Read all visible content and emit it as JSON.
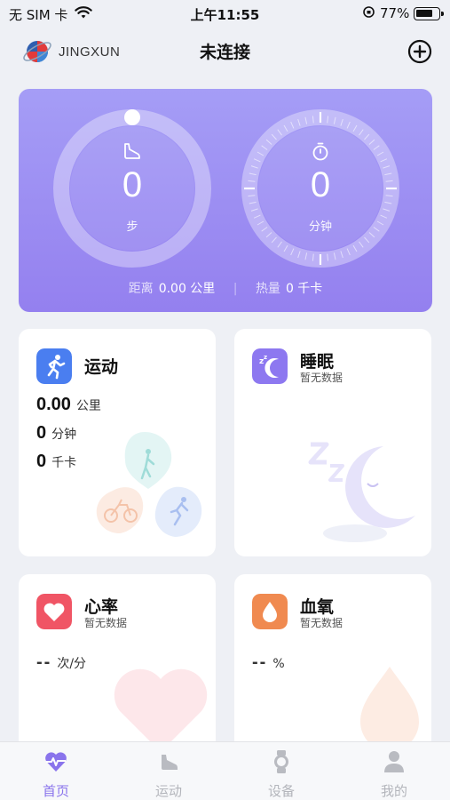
{
  "status": {
    "carrier": "无 SIM 卡",
    "time": "上午11:55",
    "battery": "77%",
    "battery_level": 0.77
  },
  "header": {
    "logo": "JINGXUN",
    "title": "未连接"
  },
  "summary": {
    "steps_value": "0",
    "steps_unit": "步",
    "duration_value": "0",
    "duration_unit": "分钟",
    "distance_label": "距离",
    "distance_value": "0.00 公里",
    "calories_label": "热量",
    "calories_value": "0 千卡",
    "separator": "|"
  },
  "cards": {
    "sport": {
      "title": "运动",
      "distance": "0.00",
      "distance_unit": "公里",
      "duration": "0",
      "duration_unit": "分钟",
      "calories": "0",
      "calories_unit": "千卡"
    },
    "sleep": {
      "title": "睡眠",
      "subtitle": "暂无数据"
    },
    "heart": {
      "title": "心率",
      "subtitle": "暂无数据",
      "value": "--",
      "unit": "次/分"
    },
    "oxygen": {
      "title": "血氧",
      "subtitle": "暂无数据",
      "value": "--",
      "unit": "%"
    }
  },
  "tabs": [
    {
      "label": "首页",
      "icon": "heart-pulse-icon",
      "active": true
    },
    {
      "label": "运动",
      "icon": "shoe-icon",
      "active": false
    },
    {
      "label": "设备",
      "icon": "watch-icon",
      "active": false
    },
    {
      "label": "我的",
      "icon": "person-icon",
      "active": false
    }
  ],
  "colors": {
    "accent": "#8a74ec",
    "hero_top": "#a59df6",
    "hero_bottom": "#9480ef",
    "sport_icon": "#4a7ef0",
    "sleep_icon": "#8d78f0",
    "heart_icon": "#f05565",
    "oxygen_icon": "#f08a50"
  }
}
